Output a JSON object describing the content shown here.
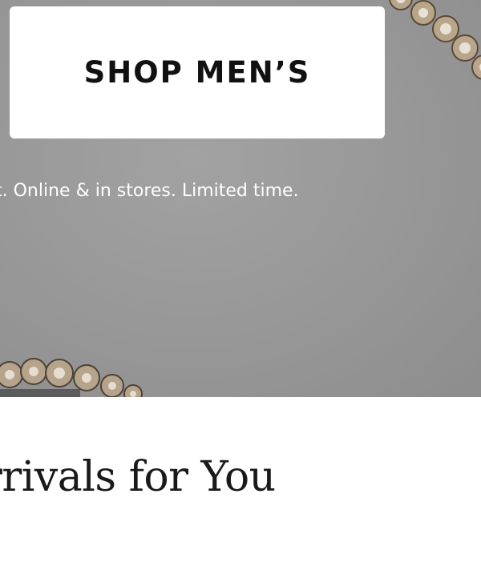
{
  "hero": {
    "cta_label": "SHOP MEN’S",
    "promo_text": "t. Online & in stores. Limited time."
  },
  "section": {
    "title": "rrivals for You"
  },
  "colors": {
    "hero_background": "#979797",
    "button_background": "#ffffff",
    "button_text": "#111111",
    "promo_text": "#ffffff",
    "title_text": "#1a1a1a"
  }
}
